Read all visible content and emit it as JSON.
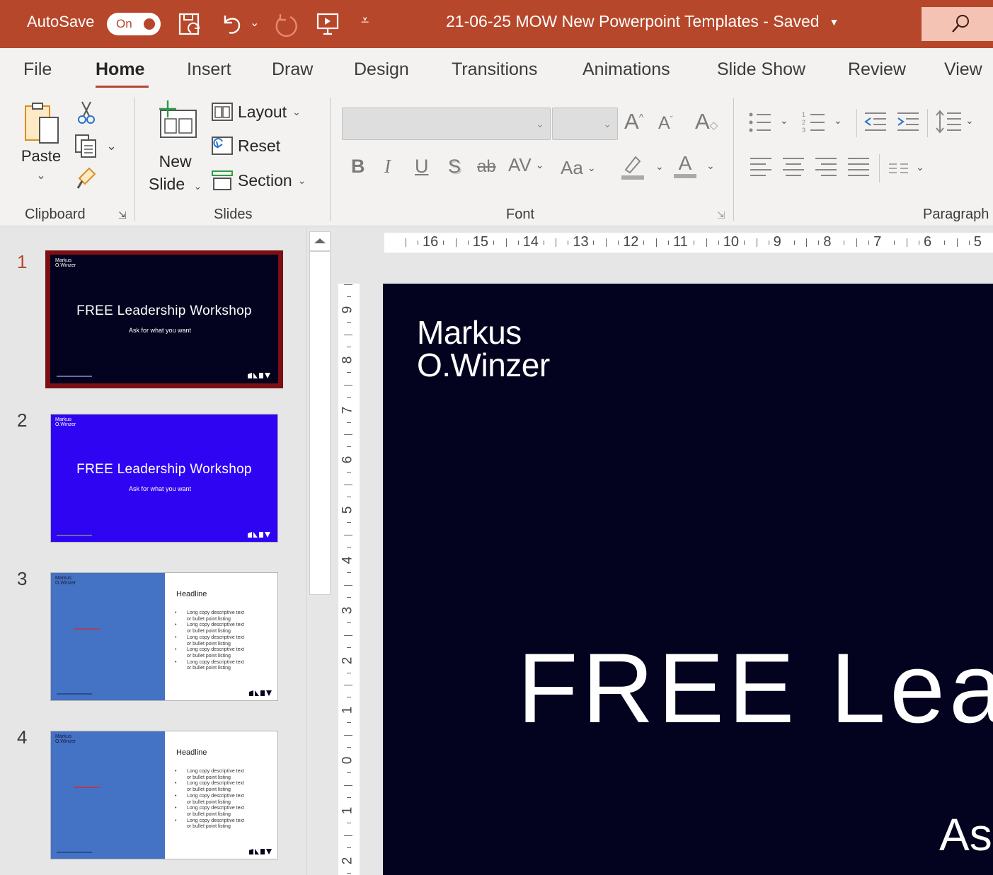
{
  "titlebar": {
    "autosave_label": "AutoSave",
    "autosave_state": "On",
    "doc_title": "21-06-25 MOW New Powerpoint Templates  -  Saved",
    "accent_color": "#b7472a"
  },
  "tabs": [
    "File",
    "Home",
    "Insert",
    "Draw",
    "Design",
    "Transitions",
    "Animations",
    "Slide Show",
    "Review",
    "View"
  ],
  "active_tab": "Home",
  "ribbon": {
    "clipboard": {
      "paste_label": "Paste",
      "group_label": "Clipboard"
    },
    "slides": {
      "new_slide_line1": "New",
      "new_slide_line2": "Slide",
      "layout_label": "Layout",
      "reset_label": "Reset",
      "section_label": "Section",
      "group_label": "Slides"
    },
    "font": {
      "group_label": "Font",
      "font_name_value": "",
      "font_size_value": "",
      "bold": "B",
      "italic": "I",
      "underline": "U",
      "shadow": "S",
      "strike": "ab",
      "spacing": "AV",
      "case": "Aa",
      "color_letter": "A"
    },
    "paragraph": {
      "group_label": "Paragraph"
    }
  },
  "thumbnails": [
    {
      "number": "1",
      "logo_line1": "Markus",
      "logo_line2": "O.Winzer",
      "title": "FREE Leadership Workshop",
      "subtitle": "Ask for what you want",
      "bg": "#03031f",
      "selected": true
    },
    {
      "number": "2",
      "logo_line1": "Markus",
      "logo_line2": "O.Winzer",
      "title": "FREE Leadership Workshop",
      "subtitle": "Ask for what you want",
      "bg": "#2f04f2",
      "selected": false
    },
    {
      "number": "3",
      "logo_line1": "Markus",
      "logo_line2": "O.Winzer",
      "headline": "Headline",
      "bullet_text_1": "Long copy descriptive text",
      "bullet_text_2": "or bullet point listing"
    },
    {
      "number": "4",
      "logo_line1": "Markus",
      "logo_line2": "O.Winzer",
      "headline": "Headline",
      "bullet_text_1": "Long copy descriptive text",
      "bullet_text_2": "or bullet point listing"
    }
  ],
  "ruler": {
    "horizontal": [
      "16",
      "15",
      "14",
      "13",
      "12",
      "11",
      "10",
      "9",
      "8",
      "7",
      "6",
      "5"
    ],
    "vertical": [
      "9",
      "8",
      "7",
      "6",
      "5",
      "4",
      "3",
      "2",
      "1",
      "0",
      "1",
      "2"
    ]
  },
  "slide": {
    "logo_line1": "Markus",
    "logo_line2": "O.Winzer",
    "title": "FREE Lea",
    "subtitle": "As",
    "bg": "#03031f"
  }
}
